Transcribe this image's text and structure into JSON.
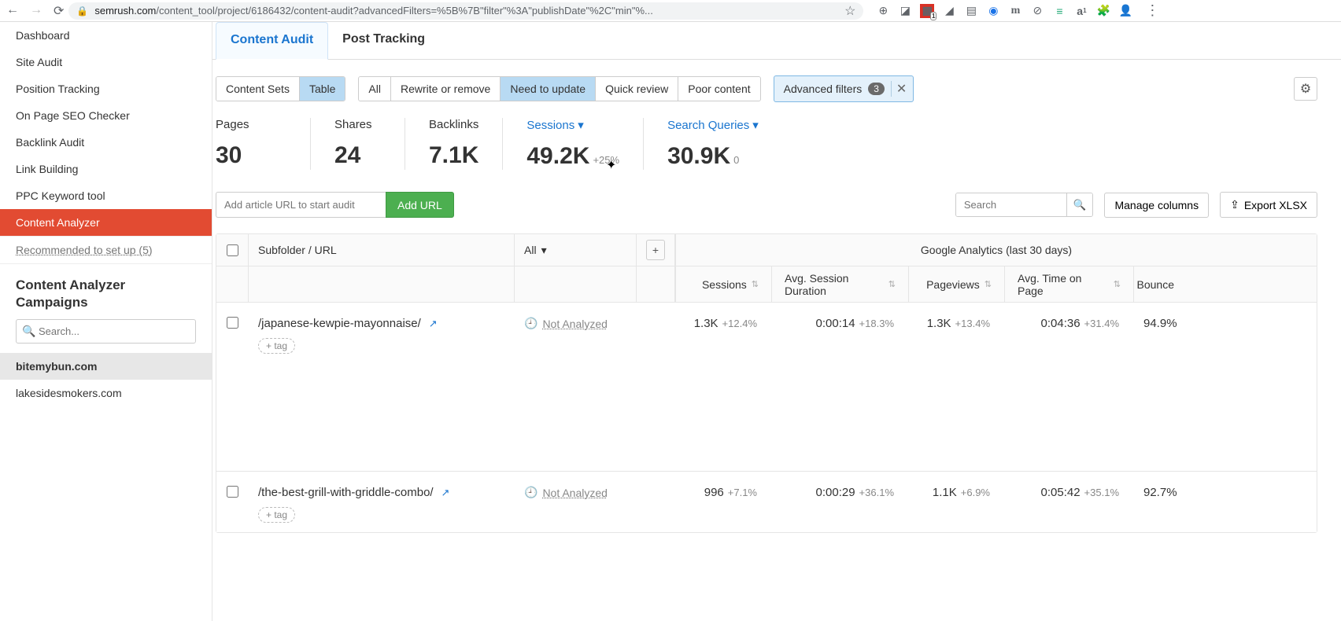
{
  "browser": {
    "url_host": "semrush.com",
    "url_path": "/content_tool/project/6186432/content-audit?advancedFilters=%5B%7B\"filter\"%3A\"publishDate\"%2C\"min\"%..."
  },
  "sidebar": {
    "items": [
      {
        "label": "Dashboard"
      },
      {
        "label": "Site Audit"
      },
      {
        "label": "Position Tracking"
      },
      {
        "label": "On Page SEO Checker"
      },
      {
        "label": "Backlink Audit"
      },
      {
        "label": "Link Building"
      },
      {
        "label": "PPC Keyword tool"
      },
      {
        "label": "Content Analyzer"
      }
    ],
    "recommended": "Recommended to set up (5)",
    "section_title_1": "Content Analyzer",
    "section_title_2": "Campaigns",
    "search_placeholder": "Search...",
    "campaigns": [
      {
        "label": "bitemybun.com"
      },
      {
        "label": "lakesidesmokers.com"
      }
    ]
  },
  "tabs": {
    "content_audit": "Content Audit",
    "post_tracking": "Post Tracking"
  },
  "filters": {
    "view": {
      "sets": "Content Sets",
      "table": "Table"
    },
    "status": {
      "all": "All",
      "rewrite": "Rewrite or remove",
      "update": "Need to update",
      "quick": "Quick review",
      "poor": "Poor content"
    },
    "adv_label": "Advanced filters",
    "adv_count": "3"
  },
  "metrics": {
    "pages": {
      "label": "Pages",
      "value": "30"
    },
    "shares": {
      "label": "Shares",
      "value": "24"
    },
    "backlinks": {
      "label": "Backlinks",
      "value": "7.1K"
    },
    "sessions": {
      "label": "Sessions",
      "value": "49.2K",
      "delta": "+25%"
    },
    "queries": {
      "label": "Search Queries",
      "value": "30.9K",
      "delta": "0"
    }
  },
  "toolbar": {
    "add_url_placeholder": "Add article URL to start audit",
    "add_url_btn": "Add URL",
    "search_placeholder": "Search",
    "manage_cols": "Manage columns",
    "export": "Export XLSX"
  },
  "table": {
    "head_url": "Subfolder / URL",
    "head_all": "All",
    "ga_group": "Google Analytics (last 30 days)",
    "col_sessions": "Sessions",
    "col_asd": "Avg. Session Duration",
    "col_pv": "Pageviews",
    "col_atp": "Avg. Time on Page",
    "col_br": "Bounce",
    "add_tag": "+ tag",
    "not_analyzed": "Not Analyzed",
    "rows": [
      {
        "url": "/japanese-kewpie-mayonnaise/",
        "sessions": "1.3K",
        "sessions_d": "+12.4%",
        "asd": "0:00:14",
        "asd_d": "+18.3%",
        "pv": "1.3K",
        "pv_d": "+13.4%",
        "atp": "0:04:36",
        "atp_d": "+31.4%",
        "br": "94.9%"
      },
      {
        "url": "/the-best-grill-with-griddle-combo/",
        "sessions": "996",
        "sessions_d": "+7.1%",
        "asd": "0:00:29",
        "asd_d": "+36.1%",
        "pv": "1.1K",
        "pv_d": "+6.9%",
        "atp": "0:05:42",
        "atp_d": "+35.1%",
        "br": "92.7%"
      }
    ]
  }
}
